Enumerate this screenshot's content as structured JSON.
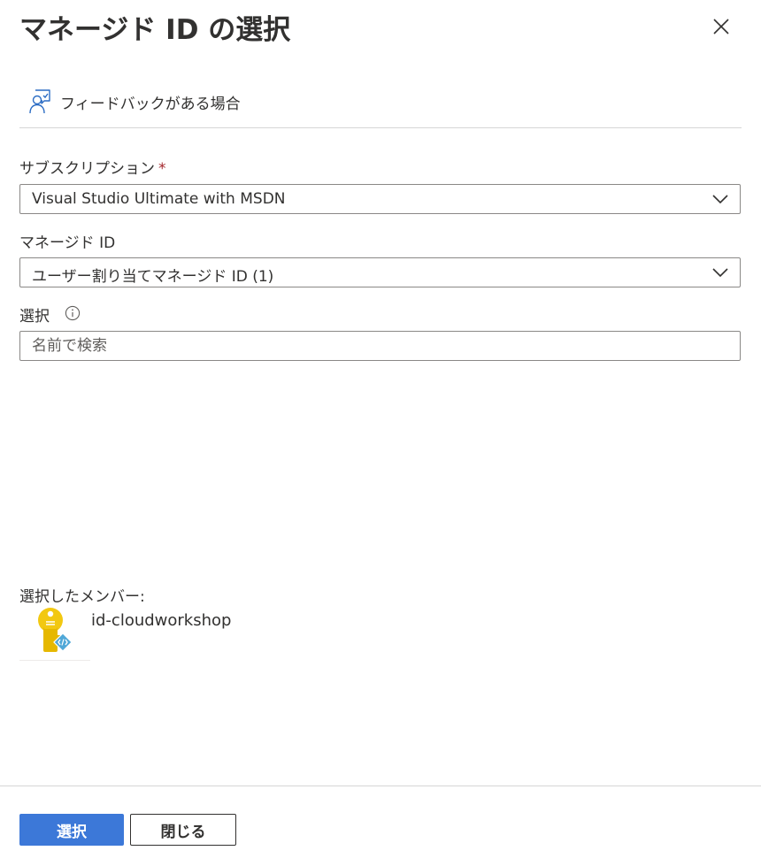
{
  "panel": {
    "title": "マネージド ID の選択",
    "close_icon": "close-icon"
  },
  "feedback": {
    "icon": "feedback-person-icon",
    "label": "フィードバックがある場合"
  },
  "subscription": {
    "label": "サブスクリプション",
    "required_mark": "*",
    "value": "Visual Studio Ultimate with MSDN"
  },
  "managed_identity": {
    "label": "マネージド ID",
    "value": "ユーザー割り当てマネージド ID (1)"
  },
  "select": {
    "label": "選択",
    "info_icon": "info-icon",
    "placeholder": "名前で検索",
    "value": ""
  },
  "selected_members": {
    "label": "選択したメンバー:",
    "items": [
      {
        "name": "id-cloudworkshop",
        "icon": "managed-identity-key-icon"
      }
    ]
  },
  "footer": {
    "select_button": "選択",
    "close_button": "閉じる"
  },
  "colors": {
    "primary": "#3c78d8",
    "required": "#a4262c",
    "text": "#323130",
    "key_gold": "#f2c811",
    "badge_blue": "#50a8d8"
  }
}
